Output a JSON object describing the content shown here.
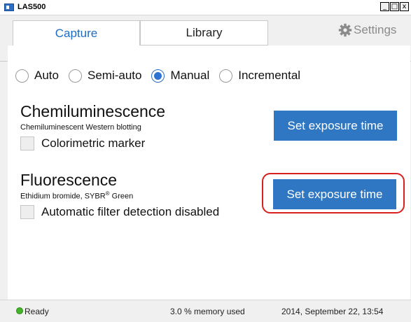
{
  "window": {
    "title": "LAS500",
    "minimize": "_",
    "maximize": "□",
    "close": "x"
  },
  "tabs": [
    {
      "label": "Capture",
      "active": true
    },
    {
      "label": "Library",
      "active": false
    }
  ],
  "settings": {
    "label": "Settings",
    "icon": "gear-icon"
  },
  "modes": [
    {
      "label": "Auto",
      "checked": false
    },
    {
      "label": "Semi-auto",
      "checked": false
    },
    {
      "label": "Manual",
      "checked": true
    },
    {
      "label": "Incremental",
      "checked": false
    }
  ],
  "chemiluminescence": {
    "title": "Chemiluminescence",
    "subtitle": "Chemiluminescent Western blotting",
    "checkbox_label": "Colorimetric marker",
    "checkbox_checked": false,
    "button_label": "Set exposure time"
  },
  "fluorescence": {
    "title": "Fluorescence",
    "subtitle_prefix": "Ethidium bromide, SYBR",
    "subtitle_sup": "®",
    "subtitle_suffix": " Green",
    "checkbox_label": "Automatic filter detection disabled",
    "checkbox_checked": false,
    "button_label": "Set exposure time"
  },
  "status": {
    "state": "Ready",
    "memory": "3.0 % memory used",
    "datetime": "2014, September 22, 13:54"
  },
  "colors": {
    "accent": "#2f77c3",
    "tab_active_text": "#1f6cc6",
    "highlight": "#d8201f",
    "status_ok": "#44b52a"
  }
}
